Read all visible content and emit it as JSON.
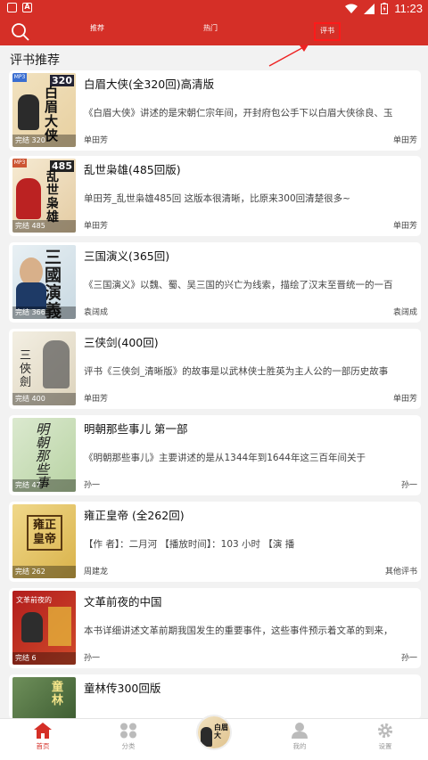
{
  "status_bar": {
    "time": "11:23",
    "left_icon": "A"
  },
  "header": {
    "tabs": [
      {
        "label": "推荐"
      },
      {
        "label": "热门"
      },
      {
        "label": "评书"
      }
    ]
  },
  "section_title": "评书推荐",
  "books": [
    {
      "title": "白眉大侠(全320回)高清版",
      "desc": "《白眉大侠》讲述的是宋朝仁宗年间，开封府包公手下以白眉大侠徐良、玉",
      "author": "单田芳",
      "author_right": "单田芳",
      "count": "完结 320",
      "cover_text": "白眉大侠",
      "cover_badge": "320"
    },
    {
      "title": "乱世枭雄(485回版)",
      "desc": "单田芳_乱世枭雄485回  这版本很清晰，比原来300回清楚很多~",
      "author": "单田芳",
      "author_right": "单田芳",
      "count": "完结 485",
      "cover_text": "乱世枭雄",
      "cover_badge": "485"
    },
    {
      "title": "三国演义(365回)",
      "desc": "《三国演义》以魏、蜀、吴三国的兴亡为线索，描绘了汉末至晋统一的一百",
      "author": "袁阔成",
      "author_right": "袁阔成",
      "count": "完结 366",
      "cover_text": "三國演義",
      "cover_badge": ""
    },
    {
      "title": "三侠剑(400回)",
      "desc": "评书《三侠剑_清晰版》的故事是以武林侠士胜英为主人公的一部历史故事",
      "author": "单田芳",
      "author_right": "单田芳",
      "count": "完结 400",
      "cover_text": "三俠劍",
      "cover_badge": ""
    },
    {
      "title": "明朝那些事儿 第一部",
      "desc": "《明朝那些事儿》主要讲述的是从1344年到1644年这三百年间关于",
      "author": "孙一",
      "author_right": "孙一",
      "count": "完结 47",
      "cover_text": "明朝那些事",
      "cover_badge": ""
    },
    {
      "title": "雍正皇帝 (全262回)",
      "desc": "【作    者】：二月河  【播放时间】：103    小时   【演  播",
      "author": "周建龙",
      "author_right": "其他评书",
      "count": "完结 262",
      "cover_text": "雍正皇帝",
      "cover_badge": ""
    },
    {
      "title": "文革前夜的中国",
      "desc": "本书详细讲述文革前期我国发生的重要事件，这些事件预示着文革的到来，",
      "author": "孙一",
      "author_right": "孙一",
      "count": "完结 6",
      "cover_text": "文革前夜的",
      "cover_badge": ""
    },
    {
      "title": "童林传300回版",
      "desc": "",
      "author": "",
      "author_right": "",
      "count": "",
      "cover_text": "童林",
      "cover_badge": ""
    }
  ],
  "bottom_nav": [
    {
      "label": "首页",
      "icon": "home-icon"
    },
    {
      "label": "分类",
      "icon": "category-icon"
    },
    {
      "label": "我的",
      "icon": "user-icon"
    },
    {
      "label": "设置",
      "icon": "gear-icon"
    }
  ],
  "colors": {
    "brand": "#d52f27",
    "annotation": "#ff1a1a"
  }
}
